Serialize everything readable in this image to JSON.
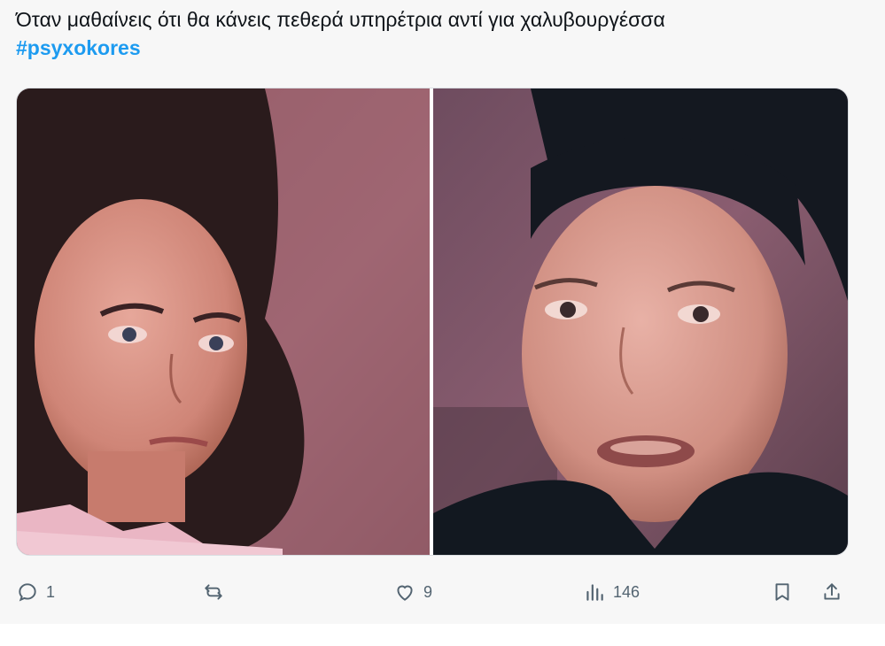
{
  "tweet": {
    "text": "Όταν μαθαίνεις ότι θα κάνεις πεθερά υπηρέτρια αντί για χαλυβουργέσσα",
    "hashtag": "#psyxokores"
  },
  "actions": {
    "replies": "1",
    "likes": "9",
    "views": "146"
  },
  "icons": {
    "reply": "reply-icon",
    "retweet": "retweet-icon",
    "like": "like-icon",
    "views": "views-icon",
    "bookmark": "bookmark-icon",
    "share": "share-icon"
  },
  "colors": {
    "hashtag": "#1d9bf0",
    "icon": "#536471",
    "background": "#f7f7f7"
  }
}
